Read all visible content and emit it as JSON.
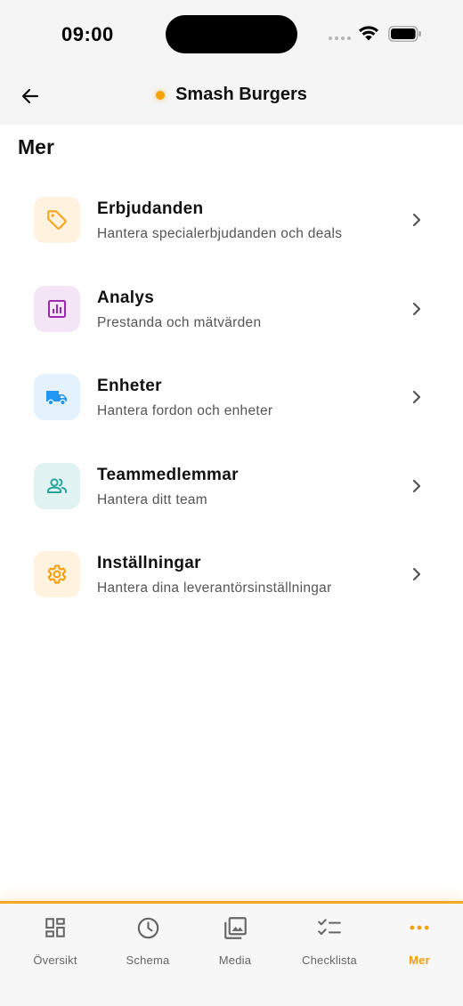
{
  "status": {
    "time": "09:00"
  },
  "header": {
    "title": "Smash Burgers",
    "dot_color": "#f5a10a"
  },
  "page": {
    "section_title": "Mer"
  },
  "menu": [
    {
      "title": "Erbjudanden",
      "subtitle": "Hantera specialerbjudanden och deals",
      "icon": "tag-icon",
      "icon_color": "#f5a623",
      "icon_bg": "#fff3e0"
    },
    {
      "title": "Analys",
      "subtitle": "Prestanda och mätvärden",
      "icon": "analytics-icon",
      "icon_color": "#9c27b0",
      "icon_bg": "#f3e5f5"
    },
    {
      "title": "Enheter",
      "subtitle": "Hantera fordon och enheter",
      "icon": "truck-icon",
      "icon_color": "#2196f3",
      "icon_bg": "#e3f2fd"
    },
    {
      "title": "Teammedlemmar",
      "subtitle": "Hantera ditt team",
      "icon": "people-icon",
      "icon_color": "#26a69a",
      "icon_bg": "#e0f2f1"
    },
    {
      "title": "Inställningar",
      "subtitle": "Hantera dina leverantörsinställningar",
      "icon": "gear-icon",
      "icon_color": "#f59e0b",
      "icon_bg": "#fff3e0"
    }
  ],
  "tabs": [
    {
      "label": "Översikt",
      "icon": "dashboard-icon",
      "active": false
    },
    {
      "label": "Schema",
      "icon": "clock-icon",
      "active": false
    },
    {
      "label": "Media",
      "icon": "gallery-icon",
      "active": false
    },
    {
      "label": "Checklista",
      "icon": "checklist-icon",
      "active": false
    },
    {
      "label": "Mer",
      "icon": "more-icon",
      "active": true
    }
  ],
  "colors": {
    "accent": "#f59e0b",
    "tab_inactive": "#666666"
  }
}
